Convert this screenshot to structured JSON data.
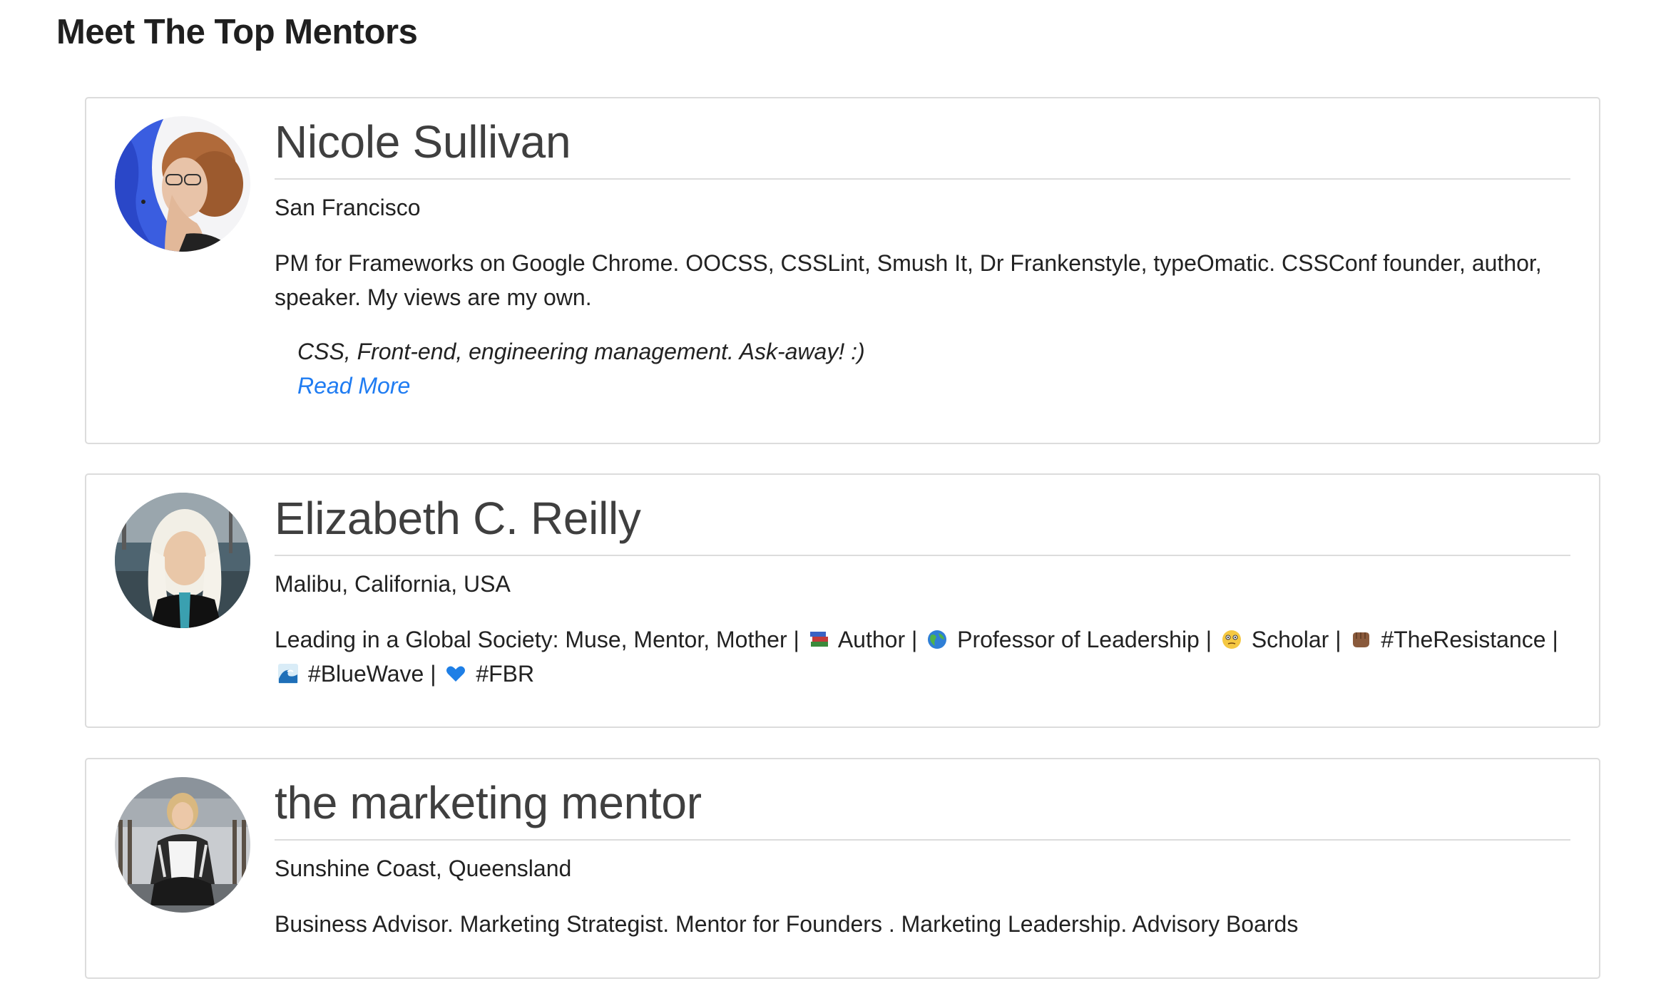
{
  "page": {
    "title": "Meet The Top Mentors"
  },
  "mentors": [
    {
      "name": "Nicole Sullivan",
      "location": "San Francisco",
      "bio": "PM for Frameworks on Google Chrome. OOCSS, CSSLint, Smush It, Dr Frankenstyle, typeOmatic. CSSConf founder, author, speaker. My views are my own.",
      "tagline": "CSS, Front-end, engineering management. Ask-away! :)",
      "read_more": "Read More",
      "avatar_icon": "mentor-photo-icon"
    },
    {
      "name": "Elizabeth C. Reilly",
      "location": "Malibu, California, USA",
      "bio_parts": [
        "Leading in a Global Society: Muse, Mentor, Mother |",
        "Author |",
        "Professor of Leadership |",
        "Scholar |",
        "#TheResistance |",
        "#BlueWave |",
        "#FBR"
      ],
      "bio_emojis": [
        "books-icon",
        "globe-icon",
        "face-icon",
        "fist-icon",
        "wave-icon",
        "blue-heart-icon"
      ],
      "avatar_icon": "mentor-photo-icon"
    },
    {
      "name": "the marketing mentor",
      "location": "Sunshine Coast, Queensland",
      "bio": "Business Advisor. Marketing Strategist. Mentor for Founders . Marketing Leadership. Advisory Boards",
      "avatar_icon": "mentor-photo-icon"
    }
  ],
  "colors": {
    "link": "#1f7cf2",
    "border": "#dcdcdc",
    "name_text": "#3f3f3f"
  }
}
